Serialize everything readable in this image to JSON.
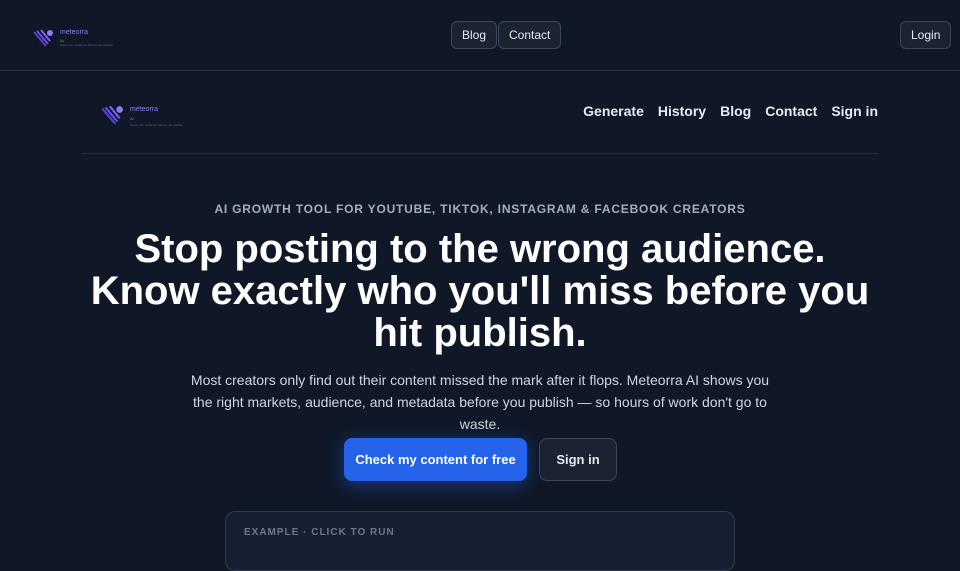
{
  "topbar": {
    "logo": {
      "name": "meteorra",
      "sub": "AI",
      "tagline": "Know your audience before you publish"
    },
    "blog_label": "Blog",
    "contact_label": "Contact",
    "login_label": "Login"
  },
  "nav": {
    "logo": {
      "name": "meteorra",
      "sub": "AI",
      "tagline": "Know your audience before you publish"
    },
    "links": [
      "Generate",
      "History",
      "Blog",
      "Contact",
      "Sign in"
    ]
  },
  "hero": {
    "eyebrow": "AI GROWTH TOOL FOR YOUTUBE, TIKTOK, INSTAGRAM & FACEBOOK CREATORS",
    "headline": "Stop posting to the wrong audience. Know exactly who you'll miss before you hit publish.",
    "subtext": "Most creators only find out their content missed the mark after it flops. Meteorra AI shows you the right markets, audience, and metadata before you publish — so hours of work don't go to waste.",
    "primary_cta": "Check my content for free",
    "secondary_cta": "Sign in"
  },
  "example": {
    "label": "EXAMPLE · CLICK TO RUN"
  },
  "colors": {
    "background": "#101828",
    "accent": "#2563eb",
    "brand": "#8f7bf5"
  }
}
